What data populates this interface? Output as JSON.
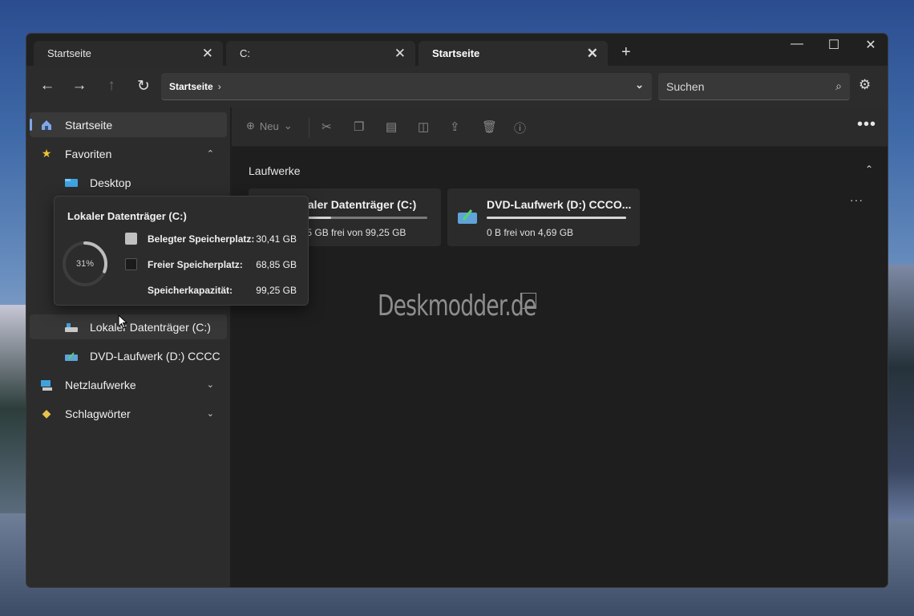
{
  "tabs": [
    {
      "label": "Startseite",
      "active": false
    },
    {
      "label": "C:",
      "active": false
    },
    {
      "label": "Startseite",
      "active": true
    }
  ],
  "window_controls": {
    "minimize": "—",
    "maximize": "☐",
    "close": "✕"
  },
  "address": {
    "crumb": "Startseite"
  },
  "search": {
    "placeholder": "Suchen"
  },
  "sidebar": {
    "items": [
      {
        "label": "Startseite",
        "icon": "home-icon",
        "selected": true
      },
      {
        "label": "Favoriten",
        "icon": "star-icon",
        "expanded": true
      },
      {
        "label": "Desktop",
        "icon": "desktop-folder-icon"
      },
      {
        "label": "Lokaler Datenträger (C:)",
        "icon": "drive-c-icon",
        "hovered": true
      },
      {
        "label": "DVD-Laufwerk (D:) CCCC",
        "icon": "dvd-drive-icon"
      },
      {
        "label": "Netzlaufwerke",
        "icon": "network-drive-icon",
        "expanded": false
      },
      {
        "label": "Schlagwörter",
        "icon": "tag-icon",
        "expanded": false
      }
    ]
  },
  "toolbar": {
    "new_label": "Neu"
  },
  "section": {
    "title": "Laufwerke"
  },
  "drives": [
    {
      "name": "Lokaler Datenträger (C:)",
      "size": "68,85 GB frei von 99,25 GB",
      "used_fraction": 0.31,
      "icon": "drive-c-icon"
    },
    {
      "name": "DVD-Laufwerk (D:) CCCO...",
      "size": "0 B frei von 4,69 GB",
      "used_fraction": 1.0,
      "icon": "dvd-drive-icon"
    }
  ],
  "watermark": "Deskmodder.de",
  "flyout": {
    "title": "Lokaler Datenträger (C:)",
    "percent": "31%",
    "percent_value": 31,
    "rows": [
      {
        "label": "Belegter Speicherplatz:",
        "value": "30,41 GB",
        "swatch": "#c0c0c0"
      },
      {
        "label": "Freier Speicherplatz:",
        "value": "68,85 GB",
        "swatch": "#1b1b1b"
      },
      {
        "label": "Speicherkapazität:",
        "value": "99,25 GB",
        "swatch": ""
      }
    ]
  },
  "colors": {
    "accent": "#7fa7e8",
    "window_bg": "#202020",
    "card_bg": "#2b2b2b"
  }
}
